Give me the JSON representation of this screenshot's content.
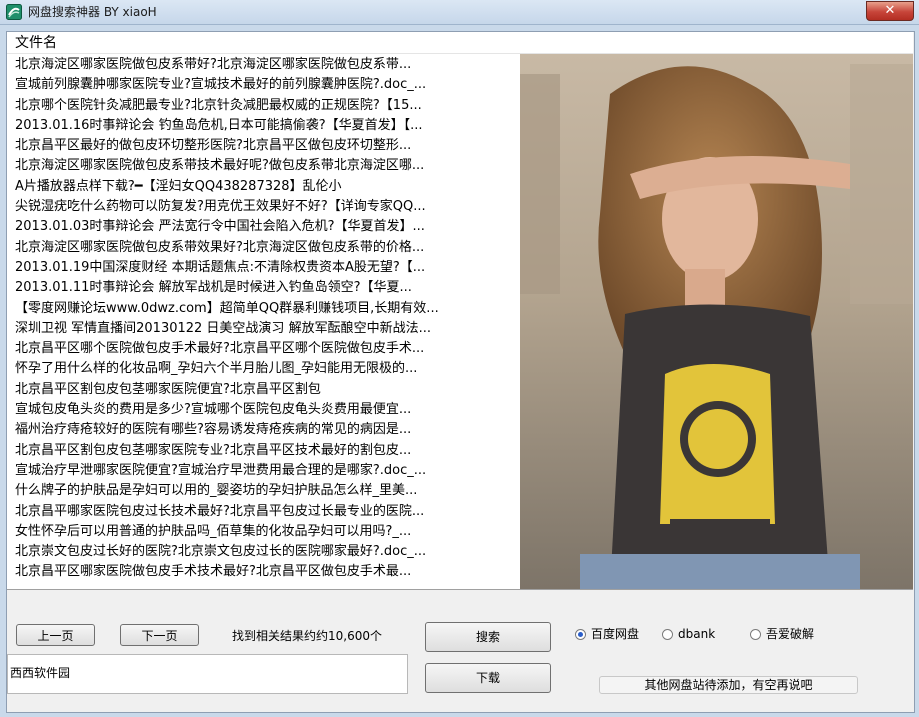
{
  "window": {
    "title": "网盘搜索神器 BY xiaoH",
    "close_label": "✕"
  },
  "list": {
    "column_header": "文件名",
    "rows": [
      "北京海淀区哪家医院做包皮系带好?北京海淀区哪家医院做包皮系带...",
      "宣城前列腺囊肿哪家医院专业?宣城技术最好的前列腺囊肿医院?.doc_...",
      "北京哪个医院针灸减肥最专业?北京针灸减肥最权威的正规医院?【15...",
      "2013.01.16时事辩论会 钓鱼岛危机,日本可能搞偷袭?【华夏首发】【...",
      "北京昌平区最好的做包皮环切整形医院?北京昌平区做包皮环切整形...",
      "北京海淀区哪家医院做包皮系带技术最好呢?做包皮系带北京海淀区哪...",
      "A片播放器点样下载?━【淫妇女QQ438287328】乱伦小",
      "尖锐湿疣吃什么药物可以防复发?用克优王效果好不好?【详询专家QQ...",
      "2013.01.03时事辩论会 严法宽行令中国社会陷入危机?【华夏首发】...",
      "北京海淀区哪家医院做包皮系带效果好?北京海淀区做包皮系带的价格...",
      "2013.01.19中国深度财经 本期话题焦点:不清除权贵资本A股无望?【...",
      "2013.01.11时事辩论会 解放军战机是时候进入钓鱼岛领空?【华夏...",
      "【零度网赚论坛www.0dwz.com】超简单QQ群暴利赚钱项目,长期有效...",
      "深圳卫视 军情直播间20130122 日美空战演习 解放军酝酿空中新战法...",
      "北京昌平区哪个医院做包皮手术最好?北京昌平区哪个医院做包皮手术...",
      "怀孕了用什么样的化妆品啊_孕妇六个半月胎儿图_孕妇能用无限极的...",
      "北京昌平区割包皮包茎哪家医院便宜?北京昌平区割包",
      "宣城包皮龟头炎的费用是多少?宣城哪个医院包皮龟头炎费用最便宜...",
      "福州治疗痔疮较好的医院有哪些?容易诱发痔疮疾病的常见的病因是...",
      "北京昌平区割包皮包茎哪家医院专业?北京昌平区技术最好的割包皮...",
      "宣城治疗早泄哪家医院便宜?宣城治疗早泄费用最合理的是哪家?.doc_...",
      "什么牌子的护肤品是孕妇可以用的_婴姿坊的孕妇护肤品怎么样_里美...",
      "北京昌平哪家医院包皮过长技术最好?北京昌平包皮过长最专业的医院...",
      "女性怀孕后可以用普通的护肤品吗_佰草集的化妆品孕妇可以用吗?_...",
      "北京崇文包皮过长好的医院?北京崇文包皮过长的医院哪家最好?.doc_...",
      "北京昌平区哪家医院做包皮手术技术最好?北京昌平区做包皮手术最..."
    ]
  },
  "controls": {
    "prev_page": "上一页",
    "next_page": "下一页",
    "result_count": "找到相关结果约约10,600个",
    "search_button": "搜索",
    "download_button": "下载",
    "text_field_value": "西西软件园",
    "radios": [
      {
        "label": "百度网盘",
        "checked": true
      },
      {
        "label": "dbank",
        "checked": false
      },
      {
        "label": "吾爱破解",
        "checked": false
      }
    ],
    "note": "其他网盘站待添加，有空再说吧"
  },
  "colors": {
    "titlebar": "#c6d7ea",
    "close_button": "#c7453a",
    "radio_selected": "#2a5ec9"
  }
}
